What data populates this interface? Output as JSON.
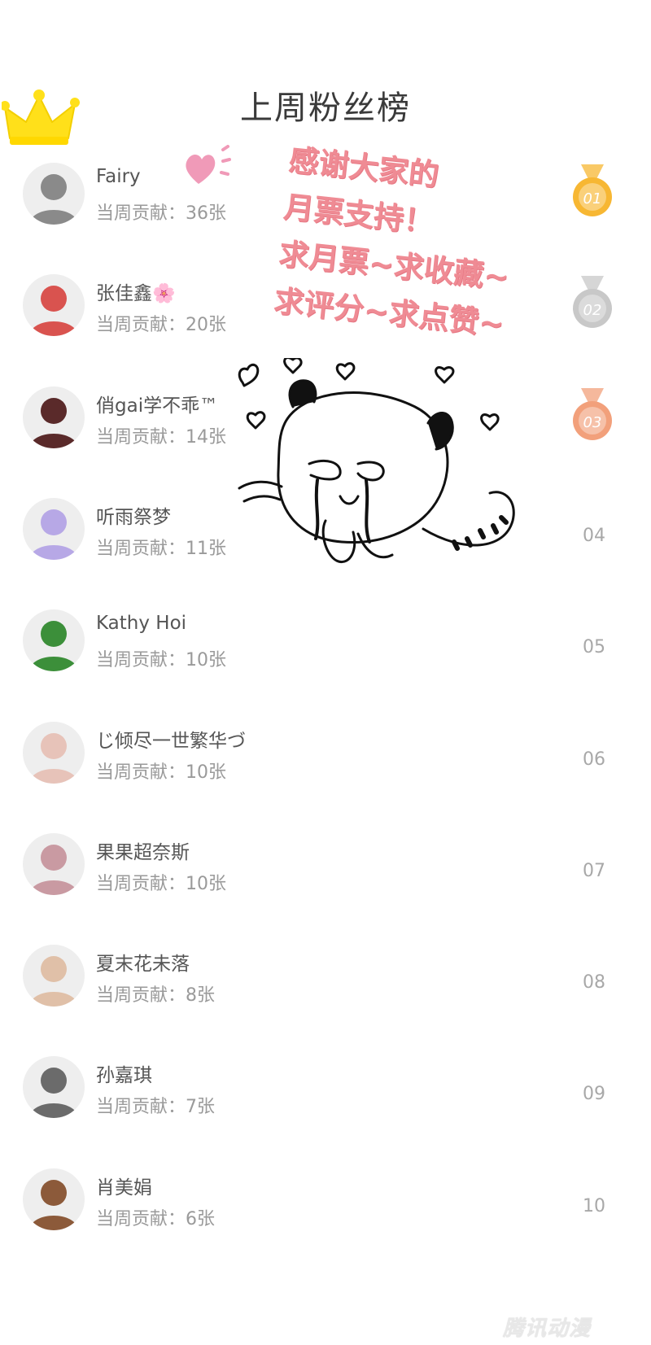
{
  "page_title": "上周粉丝榜",
  "contribution_prefix": "当周贡献：",
  "fans": [
    {
      "rank": "01",
      "name": "Fairy",
      "contribution": "当周贡献：36张",
      "medal": "gold",
      "avatar_color": "#8a8a8a"
    },
    {
      "rank": "02",
      "name": "张佳鑫🌸",
      "contribution": "当周贡献：20张",
      "medal": "silver",
      "avatar_color": "#d9534f"
    },
    {
      "rank": "03",
      "name": "俏gai学不乖™",
      "contribution": "当周贡献：14张",
      "medal": "bronze",
      "avatar_color": "#5a2a2a"
    },
    {
      "rank": "04",
      "name": "听雨祭梦",
      "contribution": "当周贡献：11张",
      "medal": "",
      "avatar_color": "#b7a8e6"
    },
    {
      "rank": "05",
      "name": "Kathy Hoi",
      "contribution": "当周贡献：10张",
      "medal": "",
      "avatar_color": "#3c8f3a"
    },
    {
      "rank": "06",
      "name": "じ倾尽一世繁华づ",
      "contribution": "当周贡献：10张",
      "medal": "",
      "avatar_color": "#e7c3b9"
    },
    {
      "rank": "07",
      "name": "果果超奈斯",
      "contribution": "当周贡献：10张",
      "medal": "",
      "avatar_color": "#c99aa2"
    },
    {
      "rank": "08",
      "name": "夏末花未落",
      "contribution": "当周贡献：8张",
      "medal": "",
      "avatar_color": "#e0c0a8"
    },
    {
      "rank": "09",
      "name": "孙嘉琪",
      "contribution": "当周贡献：7张",
      "medal": "",
      "avatar_color": "#6b6b6b"
    },
    {
      "rank": "10",
      "name": "肖美娟",
      "contribution": "当周贡献：6张",
      "medal": "",
      "avatar_color": "#8c5a3a"
    }
  ],
  "note_lines": [
    "感谢大家的",
    "月票支持！",
    "求月票~求收藏~",
    "求评分~求点赞~"
  ],
  "watermark": "腾讯动漫",
  "colors": {
    "note": "#ef8b94",
    "gold": "#f7b733",
    "silver": "#c8c8c8",
    "bronze": "#f2a07b",
    "crown": "#ffe01a"
  }
}
